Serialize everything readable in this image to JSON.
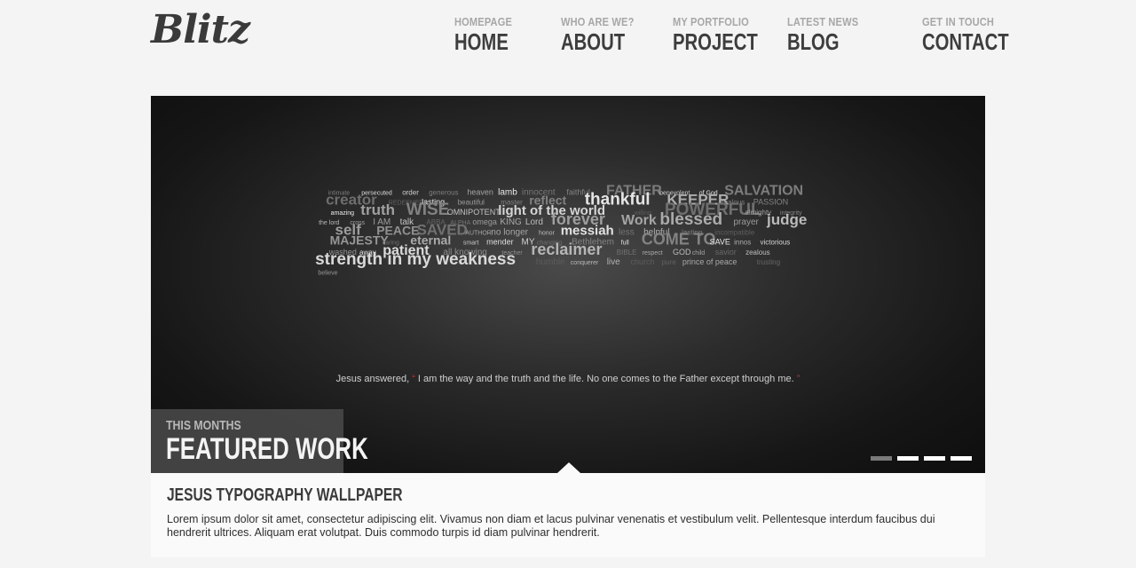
{
  "header": {
    "logo_text": "Blitz",
    "nav": [
      {
        "sub": "HOMEPAGE",
        "label": "HOME"
      },
      {
        "sub": "WHO ARE WE?",
        "label": "ABOUT"
      },
      {
        "sub": "MY PORTFOLIO",
        "label": "PROJECT"
      },
      {
        "sub": "LATEST NEWS",
        "label": "BLOG"
      },
      {
        "sub": "GET IN TOUCH",
        "label": "CONTACT"
      }
    ]
  },
  "slider": {
    "quote_prefix": "Jesus answered,",
    "quote_open": "“",
    "quote_body": "I am the way and the truth and the life. No one comes to the Father except through me.",
    "quote_close": "”",
    "featured_sub": "THIS MONTHS",
    "featured_title": "FEATURED WORK",
    "active_slide": 1,
    "slide_count": 4,
    "word_cloud": [
      "intimate",
      "persecuted",
      "order",
      "generous",
      "heaven",
      "lamb",
      "innocent",
      "faithful",
      "FATHER",
      "benevolent",
      "of God",
      "SALVATION",
      "creator",
      "REDEEMER",
      "lasting",
      "beautiful",
      "master",
      "reflect",
      "thankful",
      "KEEPER",
      "zealous",
      "PASSION",
      "amazing",
      "truth",
      "WISE",
      "OMNIPOTENT",
      "light of the world",
      "willing",
      "POWERFUL",
      "almighty",
      "integrity",
      "the lord",
      "cross",
      "I AM",
      "talk",
      "ABBA",
      "ALPHA",
      "omega",
      "KING",
      "Lord",
      "forever",
      "Work",
      "blessed",
      "prayer",
      "judge",
      "self",
      "PEACE",
      "SAVED",
      "AUTHOR",
      "no longer",
      "honor",
      "messiah",
      "less",
      "helpful",
      "lasting",
      "incompatible",
      "MAJESTY",
      "caring",
      "eternal",
      "smart",
      "mender",
      "MY",
      "changing",
      "Bethlehem",
      "full",
      "COME TO",
      "SAVE",
      "innos",
      "victorious",
      "washed",
      "away",
      "patient",
      "all knowing",
      "teacher",
      "reclaimer",
      "BIBLE",
      "respect",
      "GOD",
      "child",
      "savior",
      "zealous",
      "strength in my weakness",
      "humble",
      "conquerer",
      "live",
      "church",
      "pure",
      "prince of peace",
      "trusting",
      "believe"
    ]
  },
  "caption": {
    "title": "JESUS TYPOGRAPHY WALLPAPER",
    "text": "Lorem ipsum dolor sit amet, consectetur adipiscing elit. Vivamus non diam et lacus pulvinar venenatis et vestibulum velit. Pellentesque interdum faucibus dui hendrerit ultrices. Aliquam erat volutpat. Duis commodo turpis id diam pulvinar hendrerit."
  }
}
